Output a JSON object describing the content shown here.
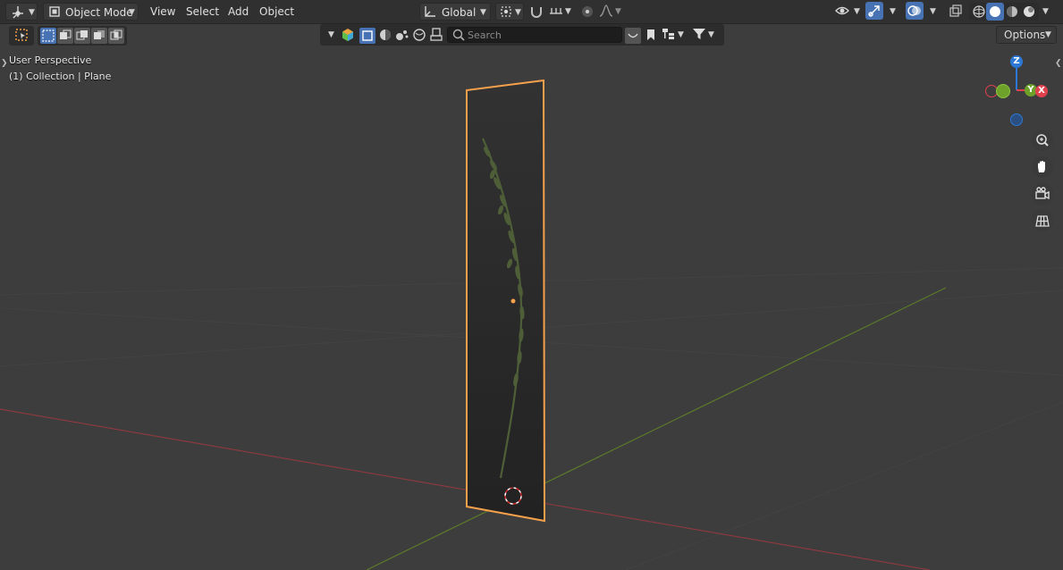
{
  "header": {
    "mode_label": "Object Mode",
    "menus": [
      "View",
      "Select",
      "Add",
      "Object"
    ],
    "orientation_label": "Global"
  },
  "toolrow": {
    "search_placeholder": "Search",
    "options_label": "Options"
  },
  "viewport": {
    "perspective_label": "User Perspective",
    "collection_label": "(1) Collection | Plane"
  },
  "gizmo": {
    "z_label": "Z",
    "y_label": "Y",
    "x_label": "X"
  },
  "colors": {
    "x_axis": "#e0414f",
    "y_axis": "#6ea129",
    "z_axis": "#2c78d6",
    "selection_outline": "#f5a04a",
    "active_tool": "#4772b3"
  },
  "icons": [
    "editor-type-icon",
    "object-mode-icon",
    "transform-pivot-icon",
    "snap-icon",
    "proportional-edit-icon",
    "visibility-icon",
    "gizmo-icon",
    "overlay-icon",
    "xray-icon",
    "shading-wireframe-icon",
    "shading-solid-icon",
    "shading-material-icon",
    "shading-rendered-icon",
    "select-box-icon",
    "zoom-icon",
    "pan-hand-icon",
    "camera-view-icon",
    "orthographic-grid-icon",
    "filter-icon",
    "bookmark-icon"
  ]
}
